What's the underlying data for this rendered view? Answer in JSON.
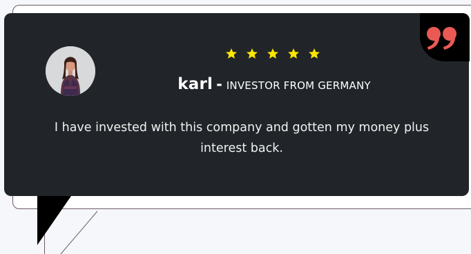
{
  "testimonial": {
    "rating": 5,
    "name": "karl",
    "separator": "-",
    "role": "INVESTOR FROM GERMANY",
    "message": "I have invested with this company and gotten my money plus interest back.",
    "quote_icon": "quote-icon",
    "avatar_icon": "avatar-photo",
    "star_icon": "star-icon"
  },
  "colors": {
    "card_bg": "#212529",
    "star": "#ffe600",
    "quote": "#ea5a55",
    "frame_border": "#6b5b62",
    "page_bg": "#f5f7fa"
  }
}
